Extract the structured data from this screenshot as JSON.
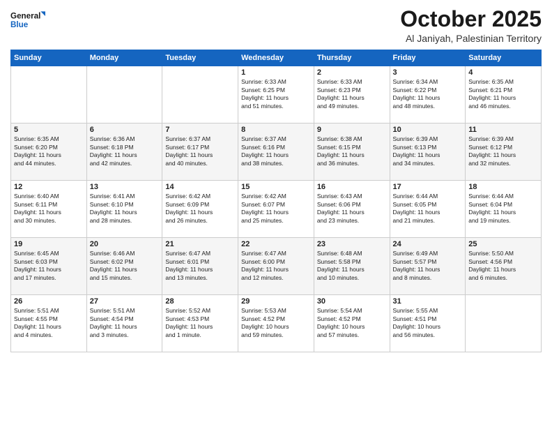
{
  "logo": {
    "line1": "General",
    "line2": "Blue"
  },
  "title": "October 2025",
  "location": "Al Janiyah, Palestinian Territory",
  "weekdays": [
    "Sunday",
    "Monday",
    "Tuesday",
    "Wednesday",
    "Thursday",
    "Friday",
    "Saturday"
  ],
  "weeks": [
    [
      {
        "day": "",
        "info": ""
      },
      {
        "day": "",
        "info": ""
      },
      {
        "day": "",
        "info": ""
      },
      {
        "day": "1",
        "info": "Sunrise: 6:33 AM\nSunset: 6:25 PM\nDaylight: 11 hours\nand 51 minutes."
      },
      {
        "day": "2",
        "info": "Sunrise: 6:33 AM\nSunset: 6:23 PM\nDaylight: 11 hours\nand 49 minutes."
      },
      {
        "day": "3",
        "info": "Sunrise: 6:34 AM\nSunset: 6:22 PM\nDaylight: 11 hours\nand 48 minutes."
      },
      {
        "day": "4",
        "info": "Sunrise: 6:35 AM\nSunset: 6:21 PM\nDaylight: 11 hours\nand 46 minutes."
      }
    ],
    [
      {
        "day": "5",
        "info": "Sunrise: 6:35 AM\nSunset: 6:20 PM\nDaylight: 11 hours\nand 44 minutes."
      },
      {
        "day": "6",
        "info": "Sunrise: 6:36 AM\nSunset: 6:18 PM\nDaylight: 11 hours\nand 42 minutes."
      },
      {
        "day": "7",
        "info": "Sunrise: 6:37 AM\nSunset: 6:17 PM\nDaylight: 11 hours\nand 40 minutes."
      },
      {
        "day": "8",
        "info": "Sunrise: 6:37 AM\nSunset: 6:16 PM\nDaylight: 11 hours\nand 38 minutes."
      },
      {
        "day": "9",
        "info": "Sunrise: 6:38 AM\nSunset: 6:15 PM\nDaylight: 11 hours\nand 36 minutes."
      },
      {
        "day": "10",
        "info": "Sunrise: 6:39 AM\nSunset: 6:13 PM\nDaylight: 11 hours\nand 34 minutes."
      },
      {
        "day": "11",
        "info": "Sunrise: 6:39 AM\nSunset: 6:12 PM\nDaylight: 11 hours\nand 32 minutes."
      }
    ],
    [
      {
        "day": "12",
        "info": "Sunrise: 6:40 AM\nSunset: 6:11 PM\nDaylight: 11 hours\nand 30 minutes."
      },
      {
        "day": "13",
        "info": "Sunrise: 6:41 AM\nSunset: 6:10 PM\nDaylight: 11 hours\nand 28 minutes."
      },
      {
        "day": "14",
        "info": "Sunrise: 6:42 AM\nSunset: 6:09 PM\nDaylight: 11 hours\nand 26 minutes."
      },
      {
        "day": "15",
        "info": "Sunrise: 6:42 AM\nSunset: 6:07 PM\nDaylight: 11 hours\nand 25 minutes."
      },
      {
        "day": "16",
        "info": "Sunrise: 6:43 AM\nSunset: 6:06 PM\nDaylight: 11 hours\nand 23 minutes."
      },
      {
        "day": "17",
        "info": "Sunrise: 6:44 AM\nSunset: 6:05 PM\nDaylight: 11 hours\nand 21 minutes."
      },
      {
        "day": "18",
        "info": "Sunrise: 6:44 AM\nSunset: 6:04 PM\nDaylight: 11 hours\nand 19 minutes."
      }
    ],
    [
      {
        "day": "19",
        "info": "Sunrise: 6:45 AM\nSunset: 6:03 PM\nDaylight: 11 hours\nand 17 minutes."
      },
      {
        "day": "20",
        "info": "Sunrise: 6:46 AM\nSunset: 6:02 PM\nDaylight: 11 hours\nand 15 minutes."
      },
      {
        "day": "21",
        "info": "Sunrise: 6:47 AM\nSunset: 6:01 PM\nDaylight: 11 hours\nand 13 minutes."
      },
      {
        "day": "22",
        "info": "Sunrise: 6:47 AM\nSunset: 6:00 PM\nDaylight: 11 hours\nand 12 minutes."
      },
      {
        "day": "23",
        "info": "Sunrise: 6:48 AM\nSunset: 5:58 PM\nDaylight: 11 hours\nand 10 minutes."
      },
      {
        "day": "24",
        "info": "Sunrise: 6:49 AM\nSunset: 5:57 PM\nDaylight: 11 hours\nand 8 minutes."
      },
      {
        "day": "25",
        "info": "Sunrise: 5:50 AM\nSunset: 4:56 PM\nDaylight: 11 hours\nand 6 minutes."
      }
    ],
    [
      {
        "day": "26",
        "info": "Sunrise: 5:51 AM\nSunset: 4:55 PM\nDaylight: 11 hours\nand 4 minutes."
      },
      {
        "day": "27",
        "info": "Sunrise: 5:51 AM\nSunset: 4:54 PM\nDaylight: 11 hours\nand 3 minutes."
      },
      {
        "day": "28",
        "info": "Sunrise: 5:52 AM\nSunset: 4:53 PM\nDaylight: 11 hours\nand 1 minute."
      },
      {
        "day": "29",
        "info": "Sunrise: 5:53 AM\nSunset: 4:52 PM\nDaylight: 10 hours\nand 59 minutes."
      },
      {
        "day": "30",
        "info": "Sunrise: 5:54 AM\nSunset: 4:52 PM\nDaylight: 10 hours\nand 57 minutes."
      },
      {
        "day": "31",
        "info": "Sunrise: 5:55 AM\nSunset: 4:51 PM\nDaylight: 10 hours\nand 56 minutes."
      },
      {
        "day": "",
        "info": ""
      }
    ]
  ]
}
